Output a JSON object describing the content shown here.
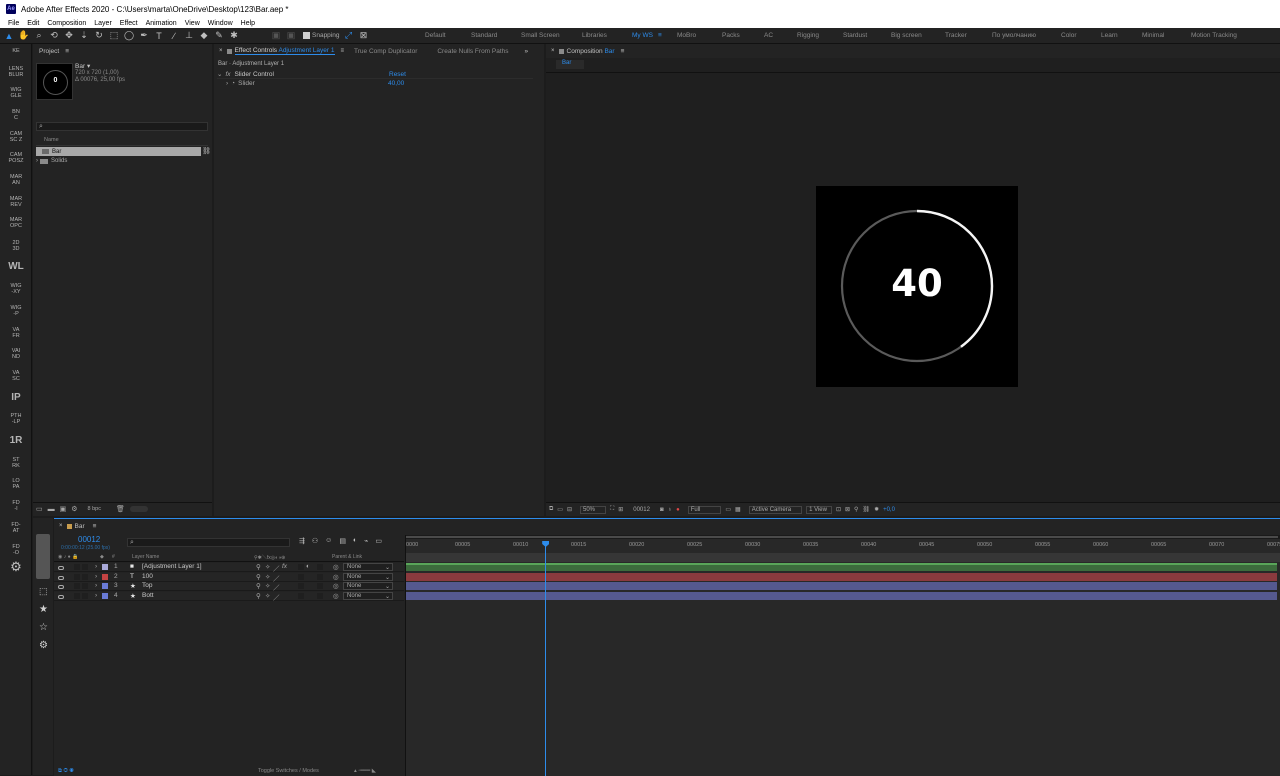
{
  "window": {
    "title": "Adobe After Effects 2020 - C:\\Users\\marta\\OneDrive\\Desktop\\123\\Bar.aep *",
    "app_badge": "Ae"
  },
  "menu": [
    "File",
    "Edit",
    "Composition",
    "Layer",
    "Effect",
    "Animation",
    "View",
    "Window",
    "Help"
  ],
  "toolbar": {
    "snapping_label": "Snapping",
    "workspaces": [
      "Default",
      "Standard",
      "Small Screen",
      "Libraries",
      "My WS",
      "MoBro",
      "Packs",
      "AC",
      "Rigging",
      "Stardust",
      "Big screen",
      "Tracker",
      "По умолчанию",
      "Color",
      "Learn",
      "Minimal",
      "Motion Tracking"
    ],
    "active_workspace": "My WS",
    "workspace_menu_icon": "≡"
  },
  "left_rail": {
    "items": [
      "KE",
      "LENS BLUR",
      "WIG GLE",
      "BN C",
      "CAM SC Z",
      "CAM POSZ",
      "MAR AN",
      "MAR REV",
      "MAR OPC",
      "2D 3D",
      "WL",
      "WIG -XY",
      "WIG -P",
      "VA FR",
      "VAI ND",
      "VA SC",
      "IP",
      "PTH -LP",
      "1R",
      "ST RK",
      "LO PA",
      "FD -I",
      "FD- AT",
      "FD -O"
    ]
  },
  "project_panel": {
    "tab_label": "Project",
    "menu_icon": "≡",
    "item_name": "Bar",
    "item_details_1": "720 x 720 (1,00)",
    "item_details_2": "Δ 00076, 25,00 fps",
    "thumb_value": "0",
    "search_placeholder": "",
    "column_name": "Name",
    "items": [
      {
        "name": "Bar",
        "type": "composition",
        "selected": true
      },
      {
        "name": "Solids",
        "type": "folder",
        "selected": false
      }
    ],
    "bpc_label": "8 bpc"
  },
  "effect_controls": {
    "tabs": [
      "Effect Controls",
      "True Comp Duplicator",
      "Create Nulls From Paths"
    ],
    "active_tab_layer": "Adjustment Layer 1",
    "breadcrumb": "Bar · Adjustment Layer 1",
    "effect_name": "Slider Control",
    "reset_label": "Reset",
    "property_name": "Slider",
    "property_value": "40,00",
    "fx_label": "fx"
  },
  "composition_panel": {
    "tab_label": "Composition",
    "comp_name": "Bar",
    "menu_icon": "≡",
    "subtab": "Bar",
    "display_number": "40",
    "ring_progress": 0.4,
    "footer": {
      "zoom": "50%",
      "timecode": "00012",
      "resolution": "Full",
      "camera": "Active Camera",
      "views": "1 View",
      "exposure": "+0,0"
    }
  },
  "timeline": {
    "tab_label": "Bar",
    "menu_icon": "≡",
    "current_time": "00012",
    "current_time_sub": "0:00:00:12 (25.00 fps)",
    "search_placeholder": "",
    "columns": {
      "layer_name": "Layer Name",
      "parent_link": "Parent & Link"
    },
    "layers": [
      {
        "num": "1",
        "name": "[Adjustment Layer 1]",
        "color": "#a9a9d8",
        "icon": "square",
        "parent": "None",
        "bar_color": "#3c6b3c"
      },
      {
        "num": "2",
        "name": "100",
        "color": "#c44343",
        "icon": "T",
        "parent": "None",
        "bar_color": "#8a3a3e"
      },
      {
        "num": "3",
        "name": "Top",
        "color": "#6a7bd6",
        "icon": "★",
        "parent": "None",
        "bar_color": "#55598f"
      },
      {
        "num": "4",
        "name": "Bott",
        "color": "#6a7bd6",
        "icon": "★",
        "parent": "None",
        "bar_color": "#55598f"
      }
    ],
    "ruler_ticks": [
      "0000",
      "00005",
      "00010",
      "00015",
      "00020",
      "00025",
      "00030",
      "00035",
      "00040",
      "00045",
      "00050",
      "00055",
      "00060",
      "00065",
      "00070",
      "00075"
    ],
    "playhead_frame": 12,
    "duration_frames": 75,
    "toggle_label": "Toggle Switches / Modes"
  },
  "colors": {
    "accent": "#2d8ceb",
    "panel_bg": "#232323",
    "app_bg": "#1c1c1c"
  }
}
